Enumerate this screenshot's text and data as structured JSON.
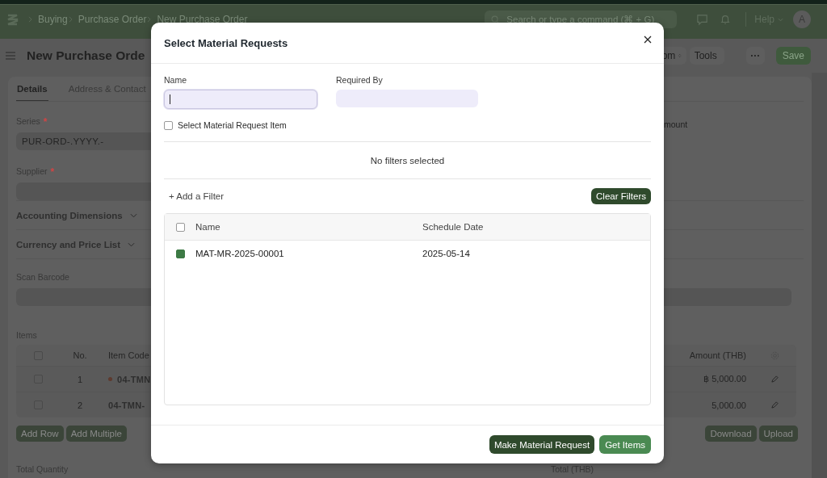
{
  "topbar": {
    "breadcrumbs": [
      "Buying",
      "Purchase Order",
      "New Purchase Order"
    ],
    "search": {
      "placeholder": "Search or type a command (⌘ + G)"
    },
    "help": "Help",
    "avatar": "A"
  },
  "page": {
    "title": "New Purchase Orde",
    "actions": [
      {
        "label": "om",
        "kind": "select"
      },
      {
        "label": "Tools",
        "kind": "select"
      },
      {
        "label": "···",
        "kind": "more"
      },
      {
        "label": "Save",
        "kind": "primary"
      }
    ],
    "tabs": [
      {
        "label": "Details",
        "selected": true
      },
      {
        "label": "Address & Contact",
        "selected": false
      }
    ],
    "fields": [
      {
        "label": "Series",
        "required_mark": "*",
        "value": "PUR-ORD-.YYYY.-"
      },
      {
        "label": "Supplier",
        "required_mark": "*"
      }
    ],
    "right_label": "mount",
    "sections": [
      {
        "label": "Accounting Dimensions"
      },
      {
        "label": "Currency and Price List"
      }
    ],
    "scan_barcode": {
      "label": "Scan Barcode"
    },
    "items": {
      "label": "Items",
      "select_all_checked": false,
      "columns": [
        "No.",
        "Item Code",
        "Amount (THB)"
      ],
      "rows": [
        {
          "no": "1",
          "item_code": "04-TMN",
          "amount": "฿ 5,000.00",
          "checked": false,
          "marked": true
        },
        {
          "no": "2",
          "item_code": "04-TMN-",
          "amount": "5,000.00",
          "checked": false,
          "marked": false
        }
      ],
      "buttons_left": [
        "Add Row",
        "Add Multiple"
      ],
      "buttons_right": [
        "Download",
        "Upload"
      ]
    },
    "totals": [
      "Total Quantity",
      "Total (THB)"
    ]
  },
  "dialog": {
    "title": "Select Material Requests",
    "name_field": {
      "label": "Name",
      "focused": true
    },
    "required_by_field": {
      "label": "Required By"
    },
    "item_checkbox": {
      "label": "Select Material Request Item",
      "checked": false
    },
    "filter_status": "No filters selected",
    "add_filter": "+ Add a Filter",
    "clear_filters": "Clear Filters",
    "select_all_checked": false,
    "columns": [
      "Name",
      "Schedule Date"
    ],
    "rows": [
      {
        "name": "MAT-MR-2025-00001",
        "schedule_date": "2025-05-14",
        "checked": true
      }
    ],
    "buttons": [
      {
        "label": "Make Material Request",
        "kind": "secondary"
      },
      {
        "label": "Get Items",
        "kind": "primary"
      }
    ]
  }
}
